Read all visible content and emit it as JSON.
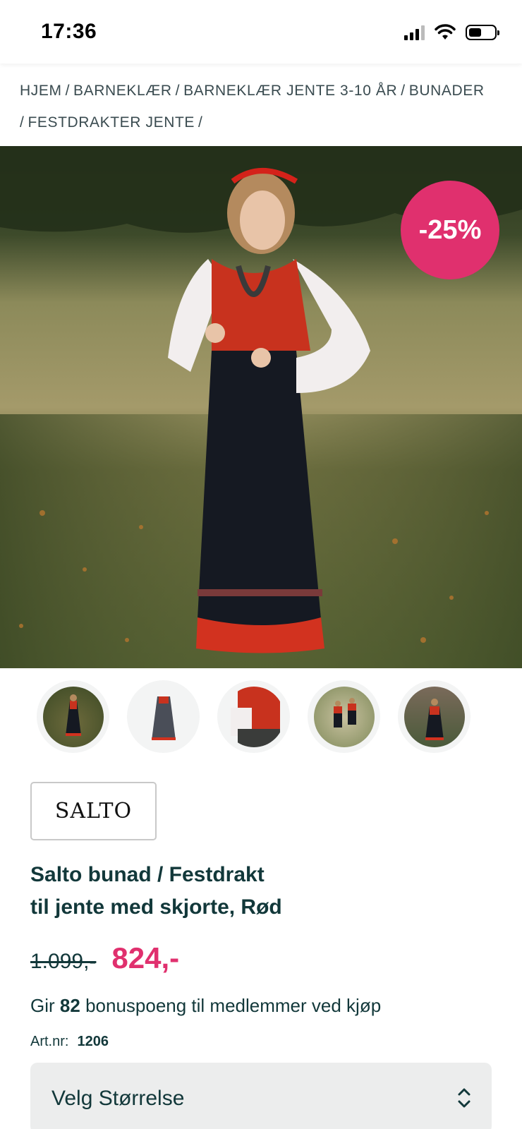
{
  "status_bar": {
    "time": "17:36"
  },
  "breadcrumb": {
    "items": [
      "HJEM",
      "BARNEKLÆR",
      "BARNEKLÆR JENTE 3-10 ÅR",
      "BUNADER",
      "FESTDRAKTER JENTE"
    ],
    "separator": "/"
  },
  "hero": {
    "discount_badge": "-25%"
  },
  "thumbnails": {
    "count": 5
  },
  "brand": {
    "name": "SALTO"
  },
  "product": {
    "title_line1": "Salto bunad / Festdrakt",
    "title_line2": "til jente med skjorte, Rød",
    "old_price": "1.099,-",
    "new_price": "824,-",
    "bonus_prefix": "Gir",
    "bonus_points": "82",
    "bonus_suffix": "bonuspoeng til medlemmer ved kjøp",
    "art_label": "Art.nr:",
    "art_value": "1206"
  },
  "size_select": {
    "label": "Velg Størrelse"
  },
  "colors": {
    "accent": "#e0306e",
    "text": "#12383a"
  }
}
